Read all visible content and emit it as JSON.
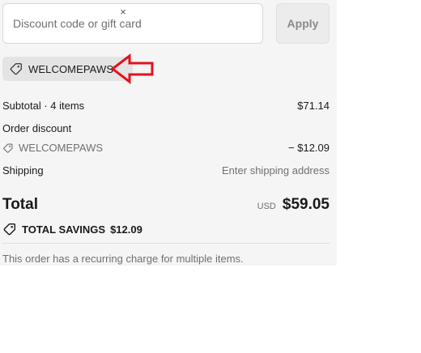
{
  "discount": {
    "placeholder": "Discount code or gift card",
    "apply_label": "Apply"
  },
  "applied_code": {
    "label": "WELCOMEPAWS",
    "tag_icon": "tag-icon",
    "remove_icon": "close-icon",
    "remove_glyph": "×"
  },
  "annotation": {
    "icon": "left-arrow-icon",
    "color": "#e0141e"
  },
  "summary": {
    "subtotal_label": "Subtotal · 4 items",
    "subtotal_value": "$71.14",
    "order_discount_label": "Order discount",
    "discount_code": "WELCOMEPAWS",
    "discount_value": "− $12.09",
    "shipping_label": "Shipping",
    "shipping_value": "Enter shipping address",
    "total_label": "Total",
    "currency": "USD",
    "total_value": "$59.05",
    "savings_label": "TOTAL SAVINGS",
    "savings_value": "$12.09",
    "note": "This order has a recurring charge for multiple items."
  }
}
